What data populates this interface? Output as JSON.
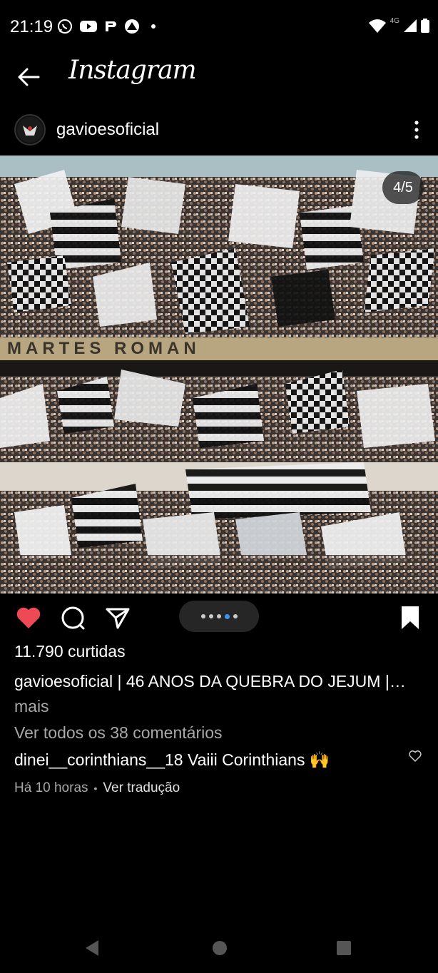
{
  "status_bar": {
    "time": "21:19",
    "left_icons": [
      "whatsapp-icon",
      "youtube-icon",
      "p-app-icon",
      "paramount-icon",
      "dot-icon"
    ],
    "right_icons": [
      "wifi-icon",
      "signal-4g-icon",
      "battery-icon"
    ],
    "network": "4G"
  },
  "app_bar": {
    "title": "Instagram",
    "back_icon": "arrow-left-icon"
  },
  "post": {
    "username": "gavioesoficial",
    "counter": "4/5",
    "likes": "11.790 curtidas",
    "caption_user": "gavioesoficial",
    "caption_text": " | 46 ANOS DA QUEBRA DO JEJUM |…",
    "caption_more": "mais",
    "view_comments": "Ver todos os 38 comentários",
    "carousel": {
      "total": 5,
      "current": 4
    },
    "top_comment": {
      "user": "dinei__corinthians__18",
      "text": " Vaiii Corinthians 🙌"
    },
    "time_ago": "Há 10 horas",
    "translate": "Ver tradução"
  },
  "colors": {
    "background": "#000000",
    "like": "#ed4956",
    "active_dot": "#3897f0",
    "muted_text": "#a8a8a8"
  }
}
